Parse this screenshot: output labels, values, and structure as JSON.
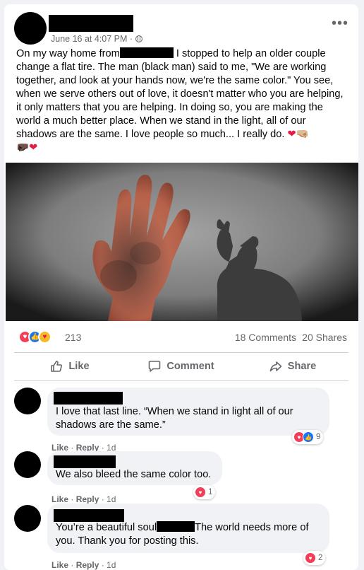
{
  "post": {
    "timestamp": "June 16 at 4:07 PM",
    "separator": "·",
    "more_options": "•••",
    "text_part1": "On my way home from",
    "text_part2": "I stopped to help an older couple change a flat tire. The man (black man) said to me, \"We are working together, and look at your hands now, we're the same color.\" You see, when we serve others out of love, it doesn't matter who you are helping, it only matters that you are helping. In doing so, you are making the world a much better place. When we stand in the light, all of our shadows are the same. I love people so much... I really do.",
    "emoji_heart_1": "❤",
    "emoji_hand_1": "🤜🏼",
    "emoji_hand_2": "🤛🏿",
    "emoji_heart_2": "❤"
  },
  "reactions": {
    "count": "213",
    "comments": "18 Comments",
    "shares": "20 Shares"
  },
  "actions": {
    "like": "Like",
    "comment": "Comment",
    "share": "Share"
  },
  "comments": [
    {
      "text": "I love that last line. “When we stand in light all of our shadows are the same.”",
      "like": "Like",
      "reply": "Reply",
      "time": "1d",
      "reaction_count": "9"
    },
    {
      "text": "We also bleed the same color too.",
      "like": "Like",
      "reply": "Reply",
      "time": "1d",
      "reaction_count": "1"
    },
    {
      "text_part1": "You’re a beautiful soul",
      "text_part2": "The world needs more of you. Thank you for posting this.",
      "like": "Like",
      "reply": "Reply",
      "time": "1d",
      "reaction_count": "2"
    }
  ],
  "colors": {
    "love": "#f33e58",
    "like": "#1877f2",
    "muted_text": "#65676b",
    "bubble": "#f0f2f5"
  }
}
